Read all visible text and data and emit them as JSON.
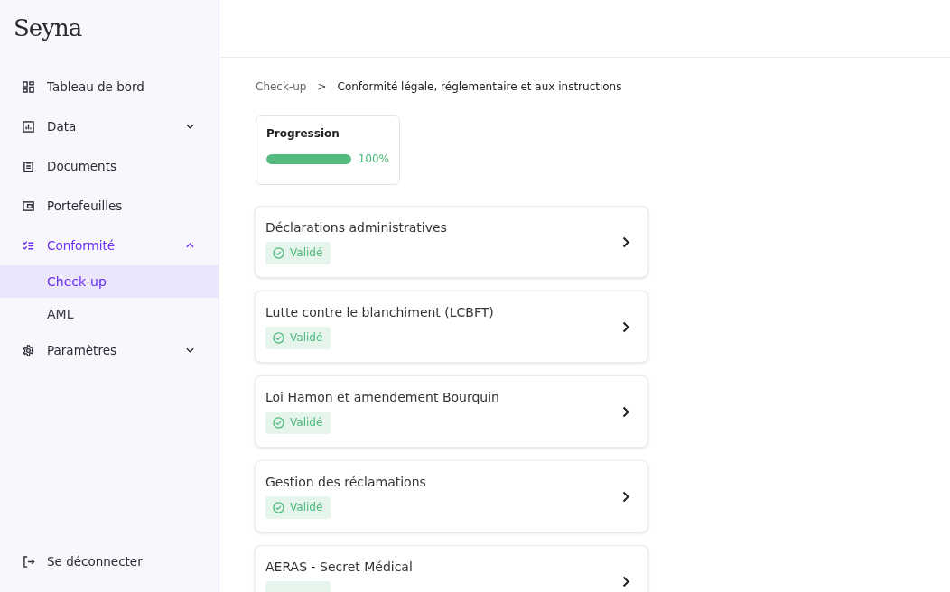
{
  "logo": "Seyna",
  "sidebar": {
    "items": [
      {
        "label": "Tableau de bord",
        "selected": false
      },
      {
        "label": "Data",
        "selected": false,
        "expanded": false
      },
      {
        "label": "Documents",
        "selected": false
      },
      {
        "label": "Portefeuilles",
        "selected": false
      },
      {
        "label": "Conformité",
        "selected": true,
        "expanded": true,
        "children": [
          {
            "label": "Check-up",
            "selected": true
          },
          {
            "label": "AML",
            "selected": false
          }
        ]
      },
      {
        "label": "Paramètres",
        "selected": false,
        "expanded": false
      }
    ],
    "logout": {
      "label": "Se déconnecter"
    }
  },
  "breadcrumb": [
    "Check-up",
    ">",
    "Conformité légale, réglementaire et aux instructions"
  ],
  "progress": {
    "title": "Progression",
    "level": 1,
    "reading": "100%"
  },
  "sections": [
    {
      "title": "Déclarations administratives",
      "status": {
        "kind": "validated",
        "label": "Validé"
      }
    },
    {
      "title": "Lutte contre le blanchiment (LCBFT)",
      "status": {
        "kind": "validated",
        "label": "Validé"
      }
    },
    {
      "title": "Loi Hamon et amendement Bourquin",
      "status": {
        "kind": "validated",
        "label": "Validé"
      }
    },
    {
      "title": "Gestion des réclamations",
      "status": {
        "kind": "validated",
        "label": "Validé"
      }
    },
    {
      "title": "AERAS - Secret Médical",
      "status": {
        "kind": "validated"
      }
    }
  ]
}
